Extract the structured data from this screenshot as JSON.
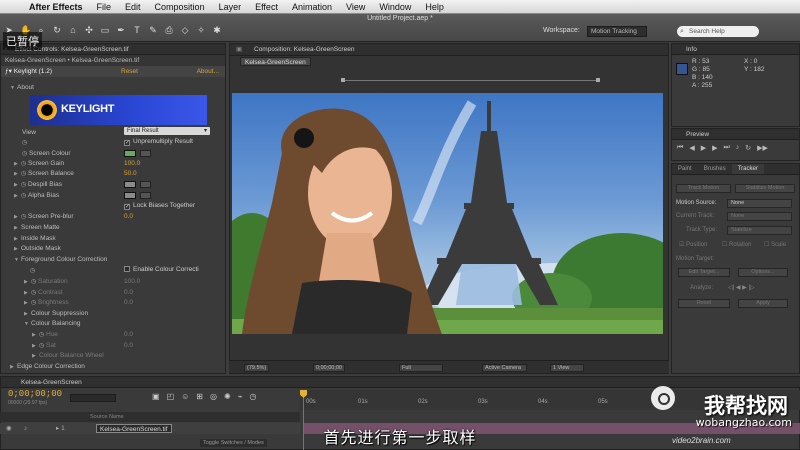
{
  "menubar": {
    "app": "After Effects",
    "items": [
      "File",
      "Edit",
      "Composition",
      "Layer",
      "Effect",
      "Animation",
      "View",
      "Window",
      "Help"
    ]
  },
  "window_title": "Untitled Project.aep *",
  "workspace": {
    "label": "Workspace:",
    "value": "Motion Tracking"
  },
  "search": {
    "placeholder": "Search Help"
  },
  "paused_label": "已暂停",
  "effect_controls": {
    "tab": "Effect Controls: Kelsea-GreenScreen.tif",
    "subtitle": "Kelsea-GreenScreen • Kelsea-GreenScreen.tif",
    "effect_name": "Keylight (1.2)",
    "reset": "Reset",
    "about": "About...",
    "logo_text": "KEYLIGHT",
    "rows": {
      "about": "About",
      "view": "View",
      "view_value": "Final Result",
      "unpremultiply": "Unpremultiply Result",
      "screen_colour": "Screen Colour",
      "screen_gain": "Screen Gain",
      "screen_gain_val": "100.0",
      "screen_balance": "Screen Balance",
      "screen_balance_val": "50.0",
      "despill_bias": "Despill Bias",
      "alpha_bias": "Alpha Bias",
      "lock_biases": "Lock Biases Together",
      "screen_preblur": "Screen Pre-blur",
      "screen_preblur_val": "0.0",
      "screen_matte": "Screen Matte",
      "inside_mask": "Inside Mask",
      "outside_mask": "Outside Mask",
      "fg_colour_correction": "Foreground Colour Correction",
      "enable_cc": "Enable Colour Correcti",
      "saturation": "Saturation",
      "saturation_val": "100.0",
      "contrast": "Contrast",
      "contrast_val": "0.0",
      "brightness": "Brightness",
      "brightness_val": "0.0",
      "colour_suppression": "Colour Suppression",
      "colour_balancing": "Colour Balancing",
      "hue": "Hue",
      "hue_val": "0.0",
      "sat": "Sat",
      "sat_val": "0.0",
      "colour_balance_wheel": "Colour Balance Wheel",
      "edge_cc": "Edge Colour Correction"
    }
  },
  "composition": {
    "tab": "Composition: Kelsea-GreenScreen",
    "crumb": "Kelsea-GreenScreen",
    "footer": {
      "zoom": "(79.5%)",
      "timecode": "0;00;00;00",
      "resolution": "Full",
      "camera": "Active Camera",
      "views": "1 View"
    }
  },
  "info": {
    "tab": "Info",
    "R": "R : 53",
    "G": "G : 85",
    "B": "B : 140",
    "A": "A : 255",
    "X": "X : 0",
    "Y": "Y : 182"
  },
  "preview": {
    "tab": "Preview"
  },
  "tracker": {
    "tabs": [
      "Paint",
      "Brushes",
      "Tracker"
    ],
    "track_motion": "Track Motion",
    "stabilize_motion": "Stabilize Motion",
    "motion_source_label": "Motion Source:",
    "motion_source_value": "None",
    "current_track_label": "Current Track:",
    "current_track_value": "None",
    "track_type_label": "Track Type:",
    "track_type_value": "Stabilize",
    "position": "Position",
    "rotation": "Rotation",
    "scale": "Scale",
    "motion_target": "Motion Target:",
    "edit_target": "Edit Target...",
    "options": "Options...",
    "analyze": "Analyze:",
    "reset": "Reset",
    "apply": "Apply"
  },
  "timeline": {
    "tab": "Kelsea-GreenScreen",
    "timecode": "0;00;00;00",
    "fps": "00000 (29.97 fps)",
    "source_name_header": "Source Name",
    "layer_name": "Kelsea-GreenScreen.tif",
    "toggle": "Toggle Switches / Modes",
    "ticks": [
      "00s",
      "01s",
      "02s",
      "03s",
      "04s",
      "05s",
      "06s"
    ]
  },
  "overlay": {
    "subtitle": "首先进行第一步取样",
    "site_name": "我帮找网",
    "site_url": "wobangzhao.com",
    "video2brain": "video2brain.com"
  },
  "colors": {
    "screen_colour": "#6aa85e",
    "accent_orange": "#d6a43a",
    "info_swatch": "#355594"
  }
}
